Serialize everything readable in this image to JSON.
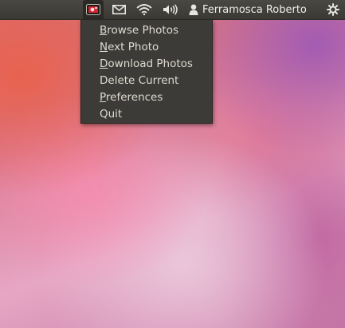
{
  "topbar": {
    "user_name": "Ferramosca Roberto",
    "indicators": [
      "photo-app-icon",
      "mail-icon",
      "wifi-icon",
      "volume-icon",
      "user-icon",
      "power-icon"
    ]
  },
  "menu": {
    "items": [
      {
        "mnemonic": "B",
        "rest": "rowse Photos"
      },
      {
        "mnemonic": "N",
        "rest": "ext Photo"
      },
      {
        "mnemonic": "D",
        "rest": "ownload Photos"
      },
      {
        "mnemonic": "",
        "rest": "Delete Current"
      },
      {
        "mnemonic": "P",
        "rest": "references"
      },
      {
        "mnemonic": "",
        "rest": "Quit"
      }
    ]
  },
  "colors": {
    "panel": "#3c3b37",
    "menu_text": "#dfdbd2",
    "app_icon_red": "#d8222b"
  }
}
